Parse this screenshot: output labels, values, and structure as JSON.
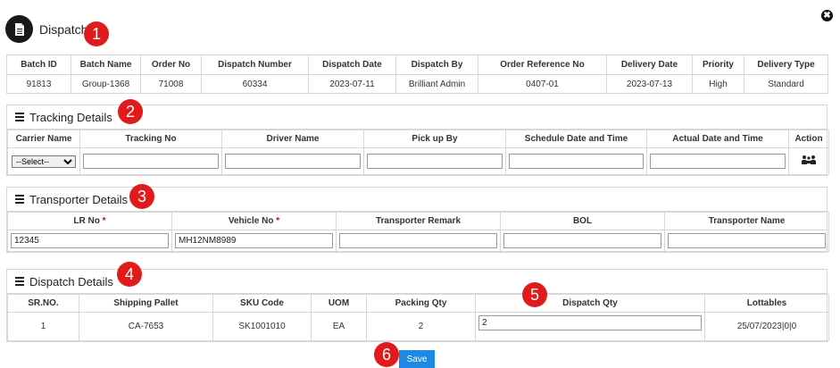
{
  "modal": {
    "title": "Dispatch",
    "close_glyph": "✖"
  },
  "badges": [
    "1",
    "2",
    "3",
    "4",
    "5",
    "6"
  ],
  "batch": {
    "headers": [
      "Batch ID",
      "Batch Name",
      "Order No",
      "Dispatch Number",
      "Dispatch Date",
      "Dispatch By",
      "Order Reference No",
      "Delivery Date",
      "Priority",
      "Delivery Type"
    ],
    "row": [
      "91813",
      "Group-1368",
      "71008",
      "60334",
      "2023-07-11",
      "Brilliant Admin",
      "0407-01",
      "2023-07-13",
      "High",
      "Standard"
    ]
  },
  "tracking": {
    "title": "Tracking Details",
    "headers": [
      "Carrier Name",
      "Tracking No",
      "Driver Name",
      "Pick up By",
      "Schedule Date and Time",
      "Actual Date and Time",
      "Action"
    ],
    "carrier_select": "--Select--"
  },
  "transporter": {
    "title": "Transporter Details",
    "headers": [
      "LR No",
      "Vehicle No",
      "Transporter Remark",
      "BOL",
      "Transporter Name"
    ],
    "required_mark": "*",
    "values": {
      "lr_no": "12345",
      "vehicle_no": "MH12NM8989",
      "remark": "",
      "bol": "",
      "name": ""
    }
  },
  "dispatch": {
    "title": "Dispatch Details",
    "headers": [
      "SR.NO.",
      "Shipping Pallet",
      "SKU Code",
      "UOM",
      "Packing Qty",
      "Dispatch Qty",
      "Lottables"
    ],
    "row": {
      "sr": "1",
      "pallet": "CA-7653",
      "sku": "SK1001010",
      "uom": "EA",
      "packing_qty": "2",
      "dispatch_qty": "2",
      "lottables": "25/07/2023|0|0"
    }
  },
  "actions": {
    "save": "Save"
  },
  "colors": {
    "badge": "#e11b1b",
    "save_button": "#1e88e5",
    "required": "#d0021b"
  }
}
